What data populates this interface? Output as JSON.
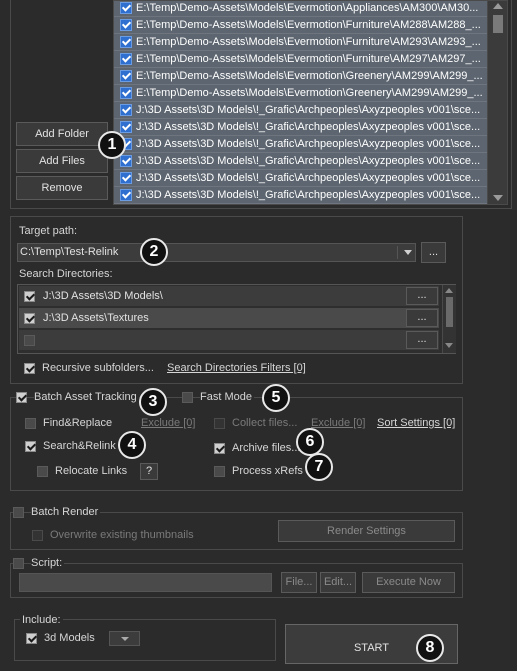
{
  "file_list": {
    "items": [
      "E:\\Temp\\Demo-Assets\\Models\\Evermotion\\Appliances\\AM300\\AM30...",
      "E:\\Temp\\Demo-Assets\\Models\\Evermotion\\Furniture\\AM288\\AM288_...",
      "E:\\Temp\\Demo-Assets\\Models\\Evermotion\\Furniture\\AM293\\AM293_...",
      "E:\\Temp\\Demo-Assets\\Models\\Evermotion\\Furniture\\AM297\\AM297_...",
      "E:\\Temp\\Demo-Assets\\Models\\Evermotion\\Greenery\\AM299\\AM299_...",
      "E:\\Temp\\Demo-Assets\\Models\\Evermotion\\Greenery\\AM299\\AM299_...",
      "J:\\3D Assets\\3D Models\\!_Grafic\\Archpeoples\\Axyzpeoples v001\\sce...",
      "J:\\3D Assets\\3D Models\\!_Grafic\\Archpeoples\\Axyzpeoples v001\\sce...",
      "J:\\3D Assets\\3D Models\\!_Grafic\\Archpeoples\\Axyzpeoples v001\\sce...",
      "J:\\3D Assets\\3D Models\\!_Grafic\\Archpeoples\\Axyzpeoples v001\\sce...",
      "J:\\3D Assets\\3D Models\\!_Grafic\\Archpeoples\\Axyzpeoples v001\\sce...",
      "J:\\3D Assets\\3D Models\\!_Grafic\\Archpeoples\\Axyzpeoples v001\\sce..."
    ],
    "add_folder": "Add Folder",
    "add_files": "Add Files",
    "remove": "Remove"
  },
  "target": {
    "label": "Target path:",
    "value": "C:\\Temp\\Test-Relink",
    "browse": "..."
  },
  "search_dirs": {
    "label": "Search Directories:",
    "items": [
      {
        "path": "J:\\3D Assets\\3D Models\\",
        "checked": true,
        "browse": "..."
      },
      {
        "path": "J:\\3D Assets\\Textures",
        "checked": true,
        "browse": "..."
      },
      {
        "path": "",
        "checked": false,
        "browse": "..."
      }
    ],
    "recursive": "Recursive subfolders...",
    "filters_link": "Search Directories Filters [0]"
  },
  "batch": {
    "tracking": "Batch Asset Tracking",
    "fast_mode": "Fast Mode",
    "find_replace": "Find&Replace",
    "exclude1": "Exclude [0]",
    "collect_files": "Collect files...",
    "exclude2": "Exclude [0]",
    "sort_settings": "Sort Settings [0]",
    "search_relink": "Search&Relink",
    "archive_files": "Archive files...",
    "relocate_links": "Relocate Links",
    "help": "?",
    "process_xrefs": "Process xRefs"
  },
  "render": {
    "label": "Batch Render",
    "overwrite": "Overwrite existing thumbnails",
    "settings": "Render Settings"
  },
  "script": {
    "label": "Script:",
    "file": "File...",
    "edit": "Edit...",
    "execute": "Execute Now"
  },
  "include": {
    "label": "Include:",
    "models": "3d Models"
  },
  "start": "START",
  "badges": [
    "1",
    "2",
    "3",
    "4",
    "5",
    "6",
    "7",
    "8"
  ],
  "colors": {
    "accent": "#2f6fd0",
    "panel": "#2b2b2b",
    "list_row": "#5d6670"
  }
}
